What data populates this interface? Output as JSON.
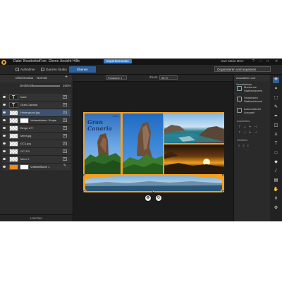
{
  "menubar": {
    "items": [
      "Datei",
      "Bearbeiten",
      "Foto",
      "Ebene",
      "Ansicht",
      "Hilfe"
    ],
    "badge": "Expertenmodus",
    "user": "Uwe Maria Merz",
    "window_controls": [
      "?",
      "—",
      "□",
      "✕"
    ]
  },
  "toolbar": {
    "buttons": [
      "Aufnahme",
      "Ganzen Studio",
      "Lightbox"
    ],
    "active_tab": "Ebenen",
    "workspace": "Organisieren und anpassen"
  },
  "layers_panel": {
    "title": "Mischmodus",
    "mode": "Normal",
    "opacity_label": "Deckkraft",
    "opacity_value": "100%",
    "add_icon": "+",
    "layers": [
      {
        "name": "Insel",
        "type": "text"
      },
      {
        "name": "Gran Canaria",
        "type": "text"
      },
      {
        "name": "Hintergrund.jpg",
        "type": "image"
      },
      {
        "name": "Verlaufsfarbe / Kopie",
        "type": "fill"
      },
      {
        "name": "Berge #??",
        "type": "image"
      },
      {
        "name": "Meer.jpg",
        "type": "image"
      },
      {
        "name": "GC1.jpg",
        "type": "image"
      },
      {
        "name": "GC 2/3",
        "type": "image"
      },
      {
        "name": "Meer 2",
        "type": "image"
      },
      {
        "name": "Vollfarbfläche 1",
        "type": "color"
      }
    ],
    "delete_label": "Löschen"
  },
  "canvas": {
    "doc_name": "Postkarte 1",
    "zoom_label": "Zoom",
    "zoom_value": "38 %",
    "collage_title": "Gran Canaria",
    "collage_subtitle": "Insel"
  },
  "right_panel": {
    "title": "Auswählen und Verschieben",
    "options": [
      "Modernes Stativnetzwerk",
      "Verstecken Stativnetzwerk",
      "Automatische Auswahl"
    ],
    "section_align": "Ausrichten",
    "section_distribute": "Verteilen"
  },
  "tools": [
    "move",
    "crop",
    "select",
    "brush",
    "pen",
    "eraser",
    "stamp",
    "text",
    "shape",
    "fill",
    "dropper",
    "gradient",
    "hand",
    "zoom"
  ]
}
